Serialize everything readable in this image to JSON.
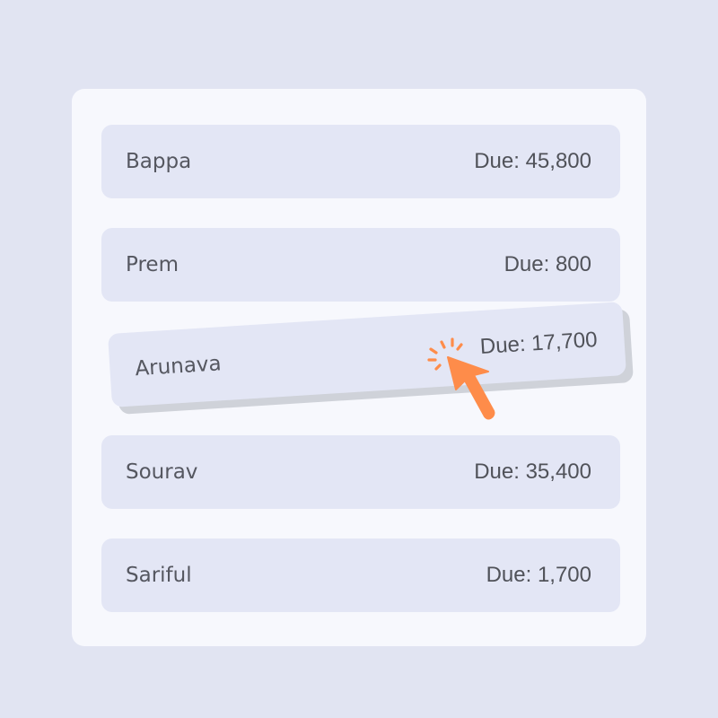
{
  "list": {
    "items": [
      {
        "name": "Bappa",
        "due": "Due: 45,800"
      },
      {
        "name": "Prem",
        "due": "Due: 800"
      },
      {
        "name": "Arunava",
        "due": "Due: 17,700"
      },
      {
        "name": "Sourav",
        "due": "Due: 35,400"
      },
      {
        "name": "Sariful",
        "due": "Due: 1,700"
      }
    ]
  },
  "colors": {
    "background": "#e1e4f2",
    "card": "#f7f8fd",
    "row": "#e3e6f5",
    "cursor": "#fe8c4a"
  },
  "cursor": {
    "icon": "pointer-arrow-icon",
    "state": "click"
  }
}
